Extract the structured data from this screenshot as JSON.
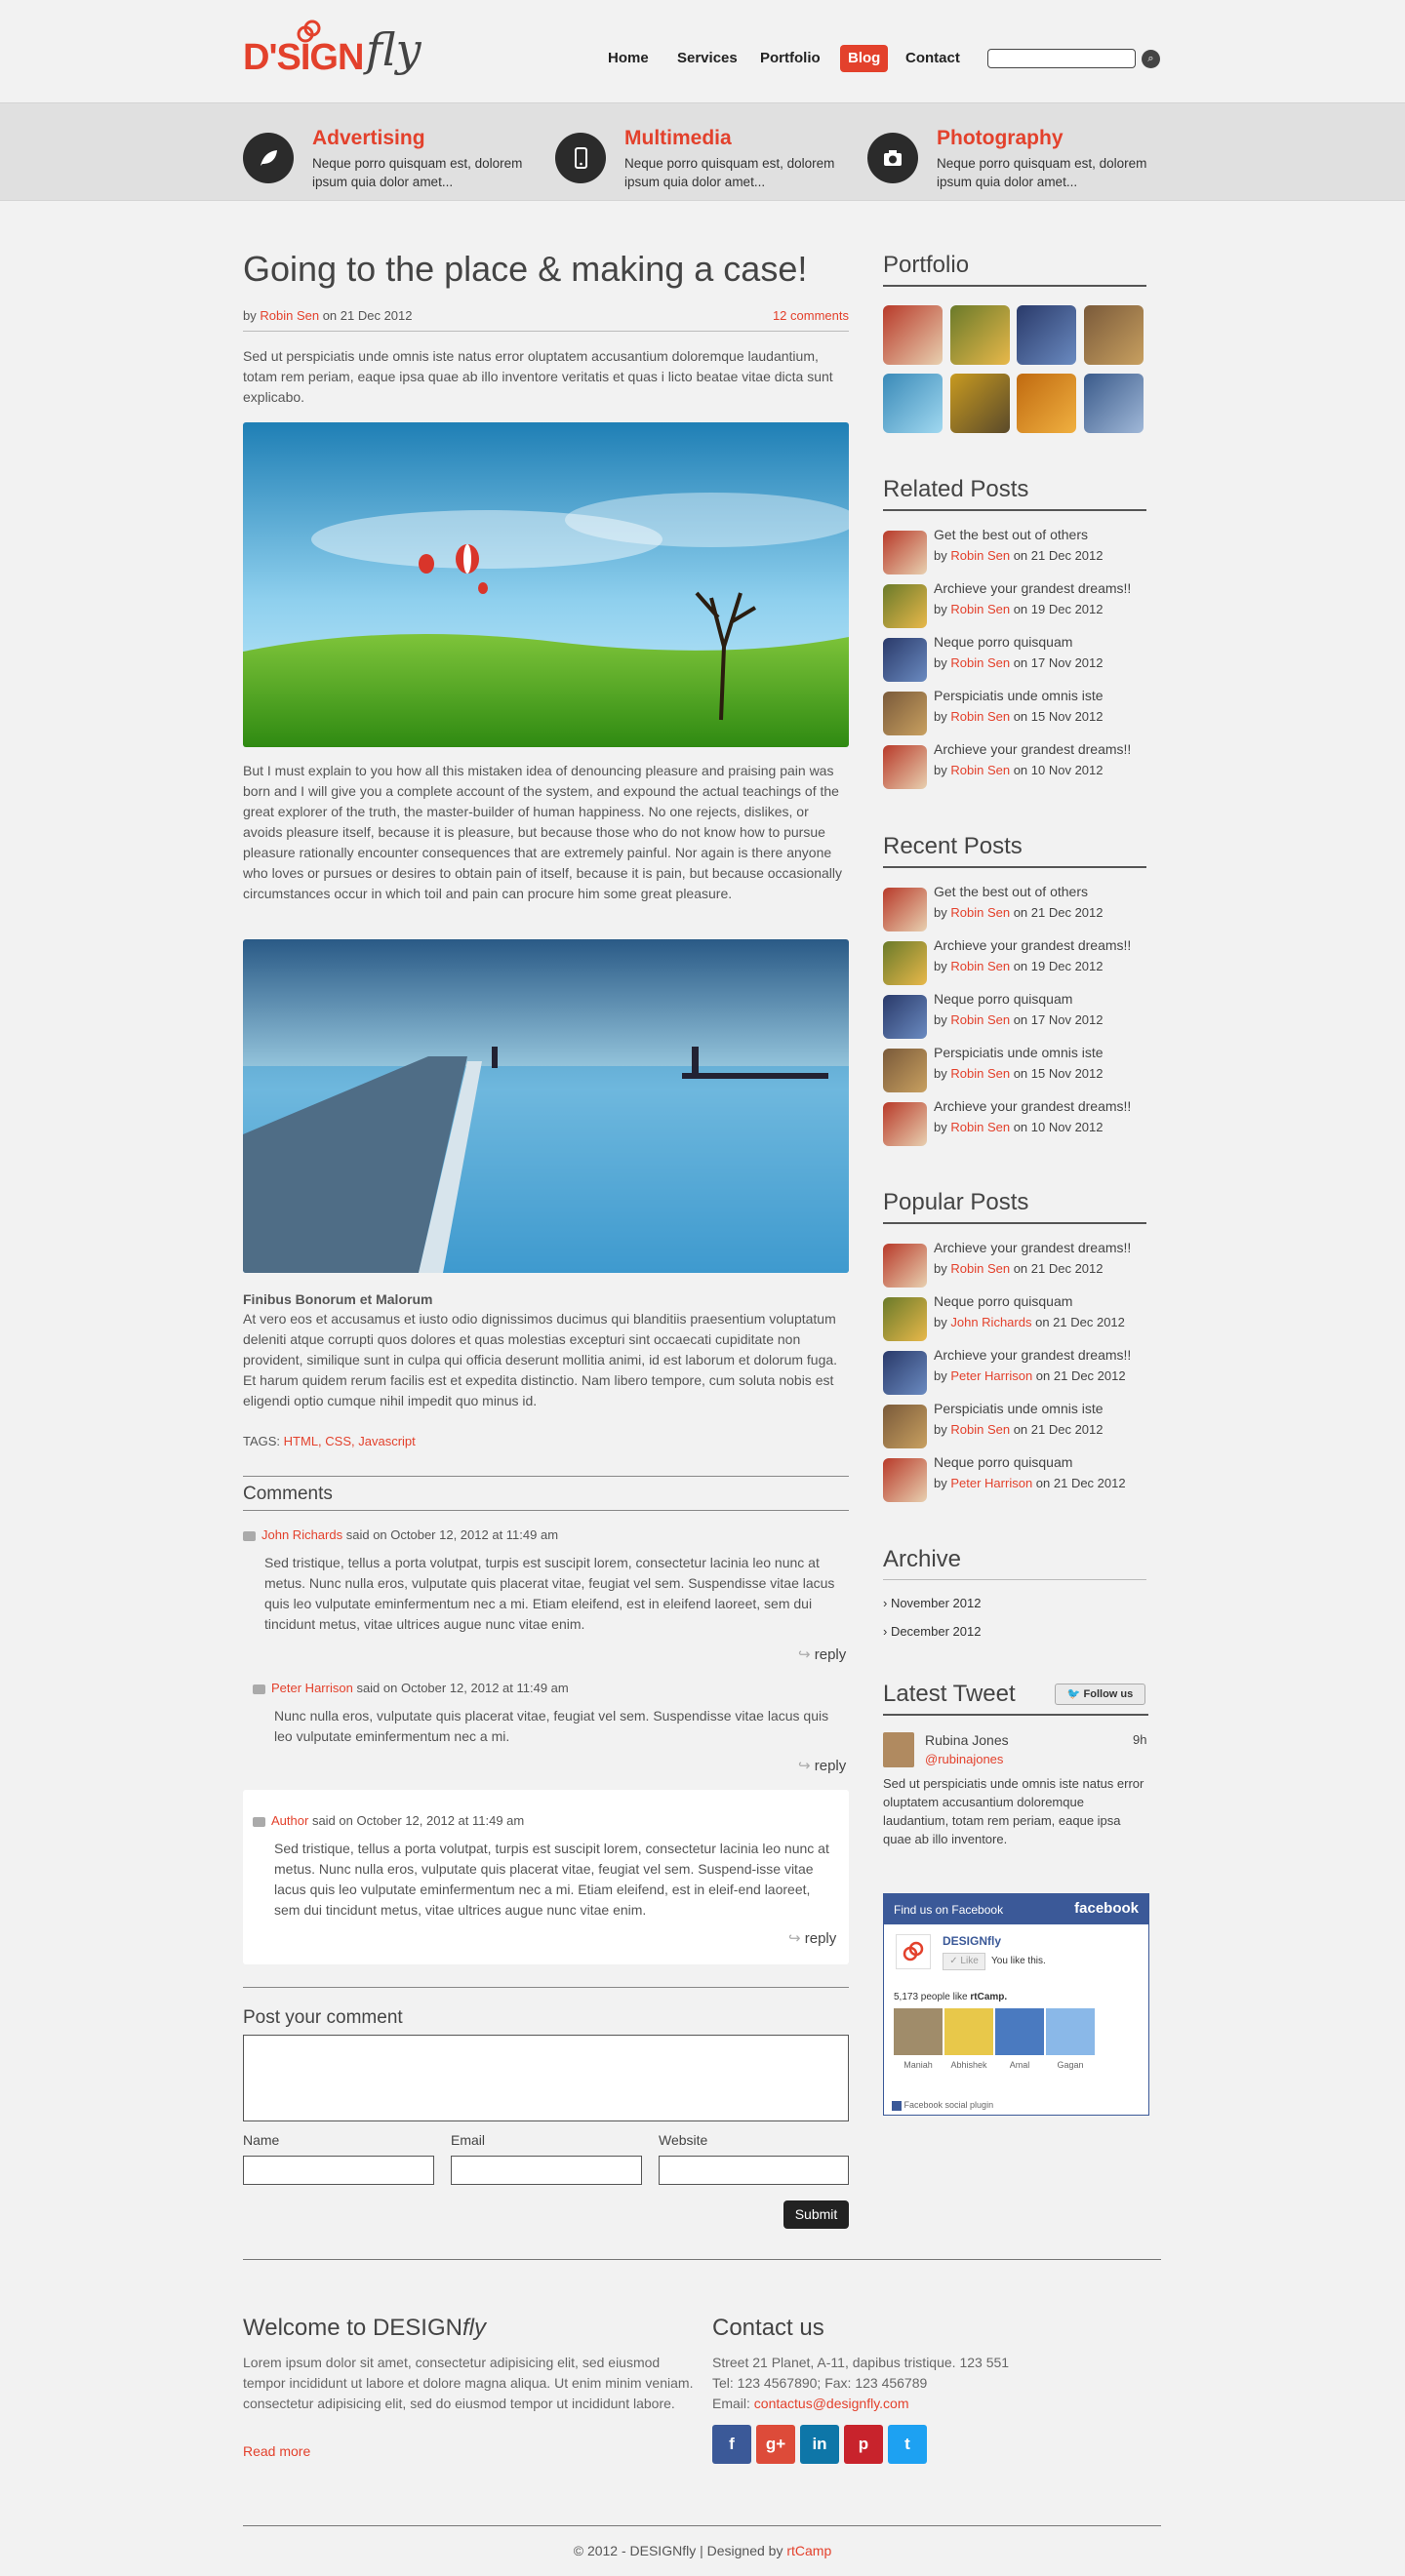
{
  "logo": {
    "mark": "D'SIGN",
    "script": "fly"
  },
  "nav": {
    "items": [
      "Home",
      "Services",
      "Portfolio",
      "Blog",
      "Contact"
    ],
    "active": "Blog",
    "search_placeholder": ""
  },
  "features": [
    {
      "title": "Advertising",
      "text": "Neque porro quisquam est, dolorem ipsum quia dolor amet...",
      "icon": "leaf-icon"
    },
    {
      "title": "Multimedia",
      "text": "Neque porro quisquam est, dolorem ipsum quia dolor amet...",
      "icon": "phone-icon"
    },
    {
      "title": "Photography",
      "text": "Neque porro quisquam est, dolorem ipsum quia dolor amet...",
      "icon": "camera-icon"
    }
  ],
  "post": {
    "title": "Going to the place & making a case!",
    "by": "by",
    "author": "Robin Sen",
    "date_prefix": "on 21 Dec 2012",
    "comments_link": "12 comments",
    "intro": "Sed ut perspiciatis unde omnis iste natus error oluptatem accusantium doloremque laudantium, totam rem periam, eaque ipsa quae ab illo inventore veritatis et quas i licto beatae vitae dicta sunt explicabo.",
    "body": "But I must explain to you how all this mistaken idea of denouncing pleasure and praising pain was born and I will give you a complete account of the system, and expound the actual teachings of the great explorer of the truth, the master-builder of human happiness. No one rejects, dislikes, or avoids pleasure itself, because it is pleasure, but because those who do not know how to pursue pleasure rationally encounter consequences that are extremely painful. Nor again is there anyone who loves or pursues or desires to obtain pain of itself, because it is pain, but because occasionally circumstances occur in which toil and pain can procure him some great pleasure.",
    "subheading": "Finibus Bonorum et Malorum",
    "body2": "At vero eos et accusamus et iusto odio dignissimos ducimus qui blanditiis praesentium voluptatum deleniti atque corrupti quos dolores et quas molestias excepturi sint occaecati cupiditate non provident, similique sunt in culpa qui officia deserunt mollitia animi, id est laborum et dolorum fuga. Et harum quidem rerum facilis est et expedita distinctio. Nam libero tempore, cum soluta nobis est eligendi optio cumque nihil impedit quo minus id.",
    "tags_label": "TAGS:",
    "tags": "HTML, CSS, Javascript"
  },
  "comments": {
    "heading": "Comments",
    "items": [
      {
        "name": "John Richards",
        "said": "said on October 12, 2012 at 11:49 am",
        "text": "Sed tristique, tellus a porta volutpat, turpis est suscipit lorem, consectetur lacinia leo nunc at metus. Nunc nulla eros, vulputate quis placerat vitae, feugiat vel sem. Suspendisse vitae lacus quis leo vulputate eminfermentum nec a mi. Etiam eleifend, est in eleifend laoreet, sem dui tincidunt metus, vitae ultrices augue nunc vitae enim.",
        "reply": "reply"
      },
      {
        "name": "Peter Harrison",
        "said": "said on October 12, 2012 at 11:49 am",
        "text": "Nunc nulla eros, vulputate quis placerat vitae, feugiat vel sem. Suspendisse vitae lacus quis leo vulputate eminfermentum nec a mi.",
        "reply": "reply"
      },
      {
        "name": "Author",
        "said": "said on October 12, 2012 at 11:49 am",
        "text": "Sed tristique, tellus a porta volutpat, turpis est suscipit lorem, consectetur lacinia leo nunc at metus. Nunc nulla eros, vulputate quis placerat vitae, feugiat vel sem. Suspend-isse vitae lacus quis leo vulputate eminfermentum nec a mi. Etiam eleifend, est in eleif-end laoreet, sem dui tincidunt metus, vitae ultrices augue nunc vitae enim.",
        "reply": "reply"
      }
    ]
  },
  "form": {
    "heading": "Post your comment",
    "name": "Name",
    "email": "Email",
    "website": "Website",
    "submit": "Submit"
  },
  "sidebar": {
    "portfolio": "Portfolio",
    "related_heading": "Related Posts",
    "related": [
      {
        "title": "Get the best out of others",
        "author": "Robin Sen",
        "date": "on 21 Dec 2012"
      },
      {
        "title": "Archieve your grandest dreams!!",
        "author": "Robin Sen",
        "date": "on 19 Dec 2012"
      },
      {
        "title": "Neque porro quisquam",
        "author": "Robin Sen",
        "date": "on 17 Nov 2012"
      },
      {
        "title": "Perspiciatis unde omnis iste",
        "author": "Robin Sen",
        "date": "on 15 Nov 2012"
      },
      {
        "title": "Archieve your grandest dreams!!",
        "author": "Robin Sen",
        "date": "on 10 Nov 2012"
      }
    ],
    "recent_heading": "Recent Posts",
    "recent": [
      {
        "title": "Get the best out of others",
        "author": "Robin Sen",
        "date": "on 21 Dec 2012"
      },
      {
        "title": "Archieve your grandest dreams!!",
        "author": "Robin Sen",
        "date": "on 19 Dec 2012"
      },
      {
        "title": "Neque porro quisquam",
        "author": "Robin Sen",
        "date": "on 17 Nov 2012"
      },
      {
        "title": "Perspiciatis unde omnis iste",
        "author": "Robin Sen",
        "date": "on 15 Nov 2012"
      },
      {
        "title": "Archieve your grandest dreams!!",
        "author": "Robin Sen",
        "date": "on 10 Nov 2012"
      }
    ],
    "popular_heading": "Popular Posts",
    "popular": [
      {
        "title": "Archieve your grandest dreams!!",
        "author": "Robin Sen",
        "date": "on 21 Dec 2012"
      },
      {
        "title": "Neque porro quisquam",
        "author": "John Richards",
        "date": "on 21 Dec 2012"
      },
      {
        "title": "Archieve your grandest dreams!!",
        "author": "Peter Harrison",
        "date": "on 21 Dec 2012"
      },
      {
        "title": "Perspiciatis unde omnis iste",
        "author": "Robin Sen",
        "date": "on 21 Dec 2012"
      },
      {
        "title": "Neque porro quisquam",
        "author": "Peter Harrison",
        "date": "on 21 Dec 2012"
      }
    ],
    "by": "by",
    "archive_heading": "Archive",
    "archive": [
      "› November 2012",
      "› December 2012"
    ],
    "tweet_heading": "Latest Tweet",
    "follow": "Follow us",
    "tweet": {
      "name": "Rubina Jones",
      "handle": "@rubinajones",
      "time": "9h",
      "text": "Sed ut perspiciatis unde omnis iste natus error oluptatem accusantium doloremque laudantium, totam rem periam, eaque ipsa quae ab illo inventore."
    },
    "facebook": {
      "find": "Find us on Facebook",
      "brand": "facebook",
      "page": "DESIGNfly",
      "like": "Like",
      "you_like": "You like this.",
      "count": "5,173 people like",
      "count_page": "rtCamp.",
      "faces": [
        "Maniah",
        "Abhishek",
        "Amal",
        "Gagan"
      ],
      "plugin": "Facebook social plugin"
    }
  },
  "footer": {
    "welcome_heading": "Welcome to DESIGN",
    "welcome_heading_em": "fly",
    "welcome_text": "Lorem ipsum dolor sit amet, consectetur adipisicing elit, sed  eiusmod tempor incididunt ut labore et dolore magna aliqua. Ut enim minim veniam. consectetur adipisicing elit, sed do eiusmod tempor ut incididunt labore.",
    "read_more": "Read more",
    "contact_heading": "Contact us",
    "address": "Street 21 Planet, A-11, dapibus tristique. 123 551",
    "tel": "Tel: 123 4567890; Fax: 123 456789",
    "email_label": "Email:",
    "email": "contactus@designfly.com",
    "social": [
      "f",
      "g+",
      "in",
      "p",
      "t"
    ],
    "copyright": "© 2012 - DESIGNfly | Designed by",
    "designer": "rtCamp"
  },
  "colors": {
    "accent": "#e3412c",
    "dark": "#2b2b2b",
    "facebook": "#3b5998"
  }
}
